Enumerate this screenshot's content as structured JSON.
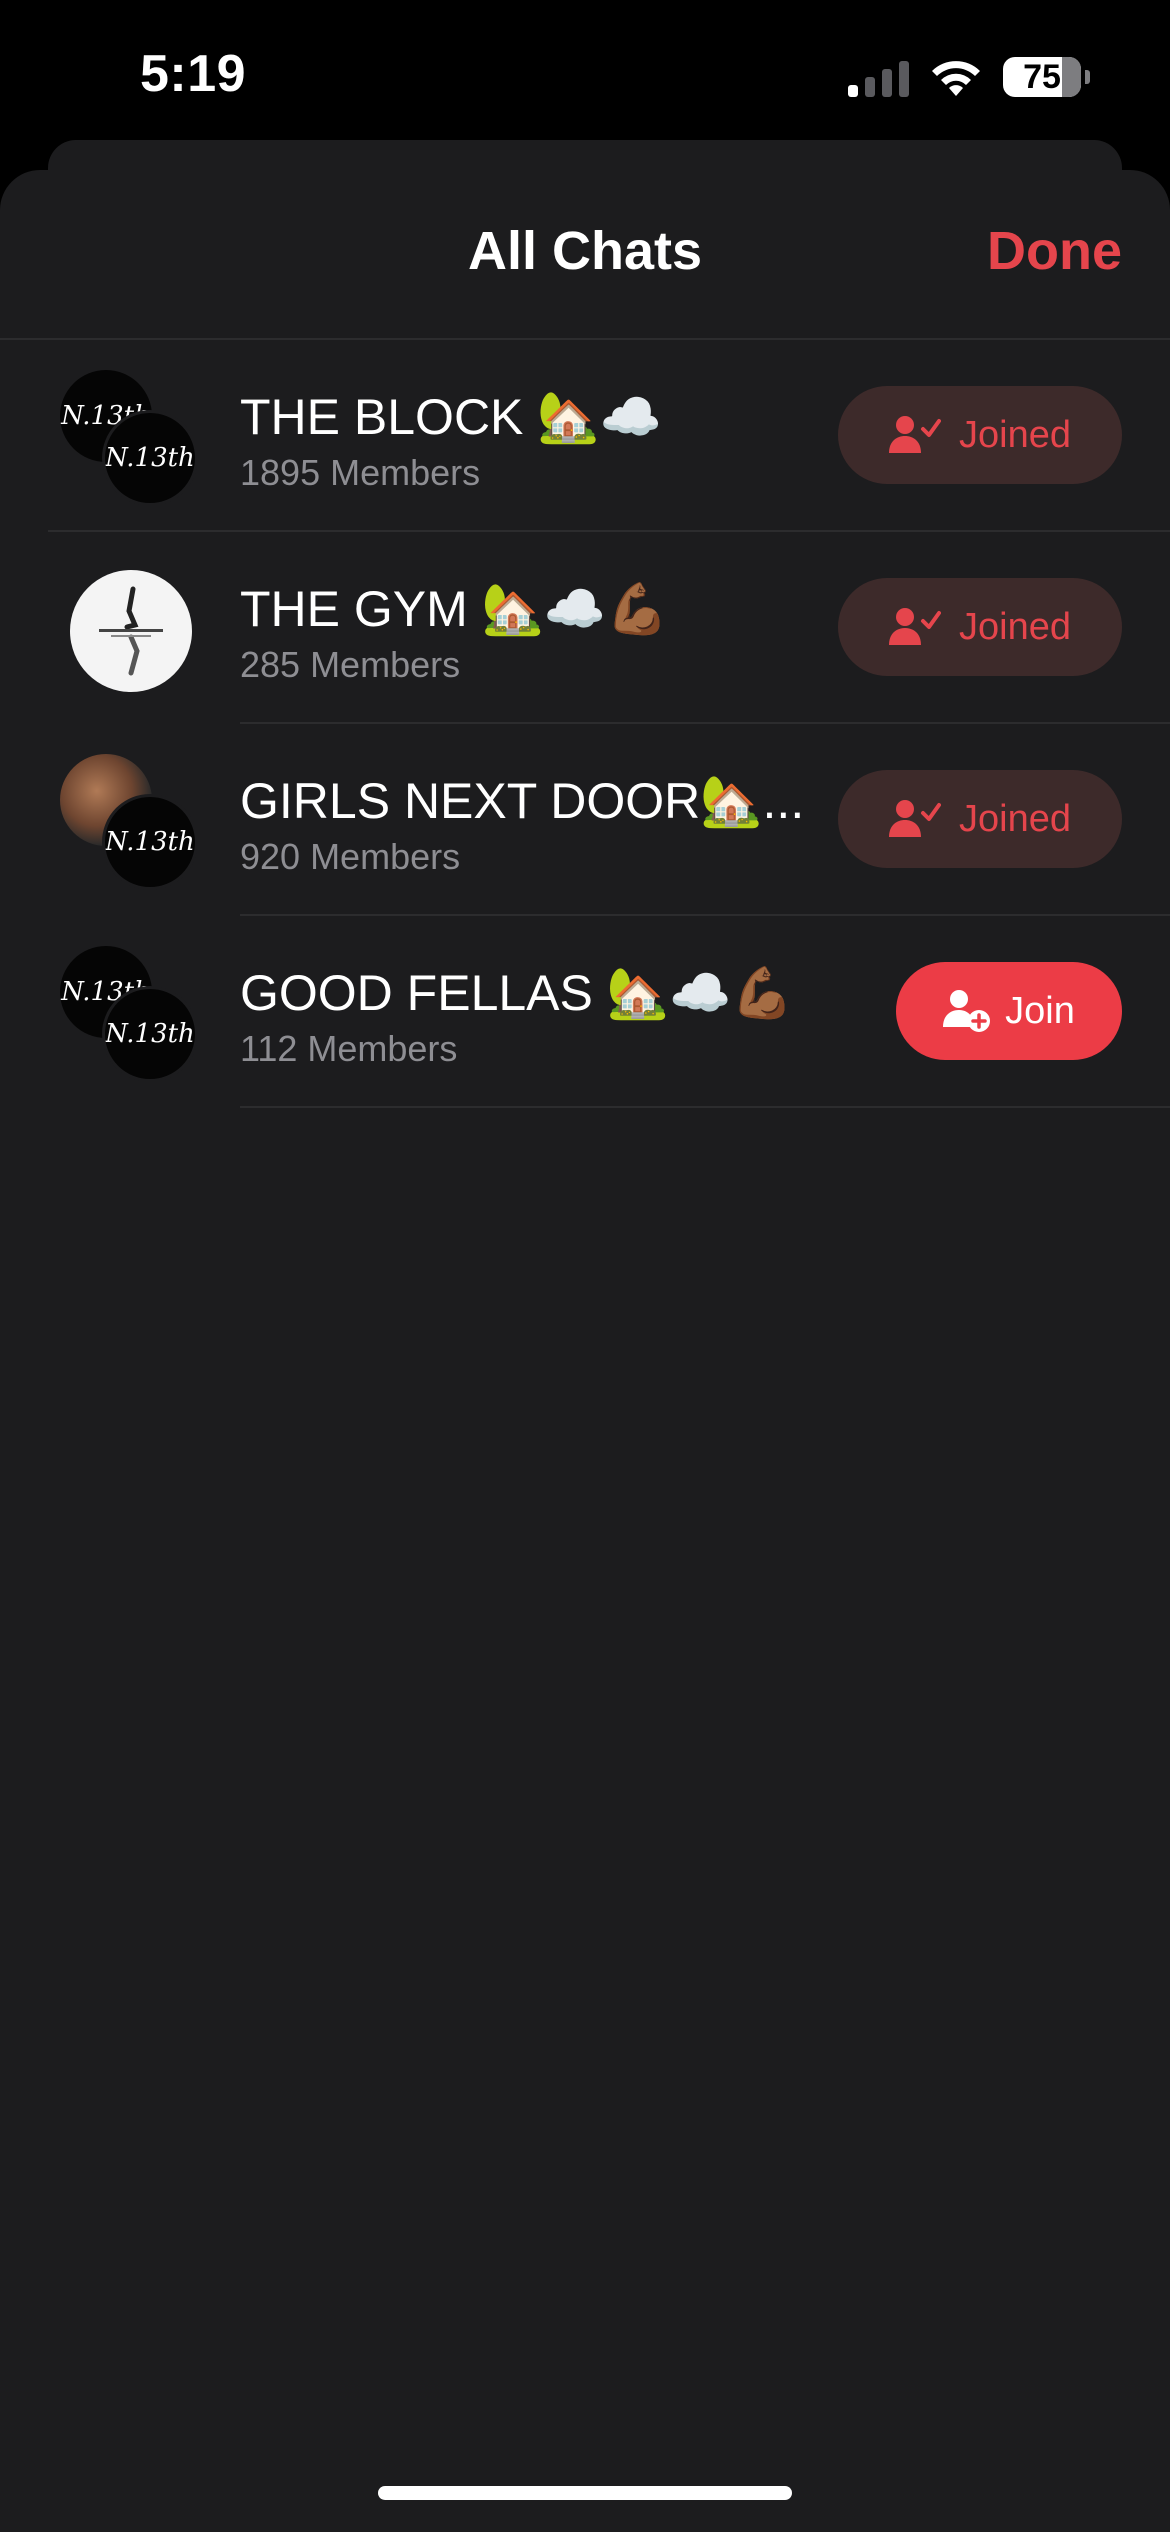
{
  "status_bar": {
    "time": "5:19",
    "battery": "75"
  },
  "header": {
    "title": "All Chats",
    "done_label": "Done"
  },
  "avatar_text": "N.13th",
  "chats": [
    {
      "name": "THE BLOCK 🏡☁️",
      "members": "1895 Members",
      "action": "Joined",
      "joined": true
    },
    {
      "name": "THE GYM 🏡☁️💪🏾",
      "members": "285 Members",
      "action": "Joined",
      "joined": true
    },
    {
      "name": "GIRLS NEXT DOOR🏡...",
      "members": "920 Members",
      "action": "Joined",
      "joined": true
    },
    {
      "name": "GOOD FELLAS 🏡☁️💪🏾",
      "members": "112 Members",
      "action": "Join",
      "joined": false
    }
  ],
  "colors": {
    "accent": "#e5454c",
    "join_bg": "#ec3c46",
    "joined_bg": "#3d2a2a",
    "sheet_bg": "#1c1c1e"
  },
  "icons": {
    "joined": "person-check-icon",
    "join": "person-add-icon"
  }
}
